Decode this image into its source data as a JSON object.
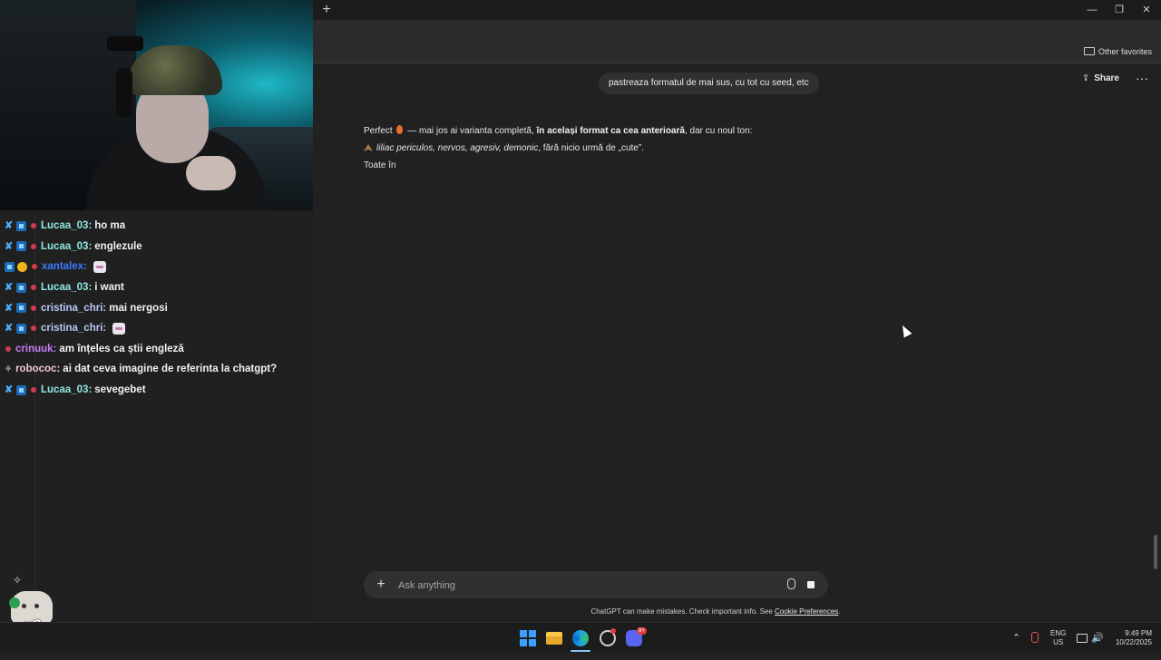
{
  "browser": {
    "newtab_label": "+",
    "window": {
      "minimize": "—",
      "restore": "❐",
      "close": "✕"
    },
    "favorites": {
      "other_label": "Other favorites"
    }
  },
  "chat": {
    "share_label": "Share",
    "more_label": "···",
    "user_message": "pastreaza formatul de mai sus, cu tot cu seed, etc",
    "assistant": {
      "line1_start": "Perfect",
      "line1_mid": " — mai jos ai varianta completă, ",
      "line1_bold": "în același format ca cea anterioară",
      "line1_end": ", dar cu noul ton:",
      "line2_italic": "liliac periculos, nervos, agresiv, demonic",
      "line2_end": ", fără nicio urmă de „cute”.",
      "line3": "Toate în"
    },
    "composer": {
      "placeholder": "Ask anything",
      "plus_label": "+"
    },
    "disclaimer_text": "ChatGPT can make mistakes. Check important info. See ",
    "disclaimer_link": "Cookie Preferences",
    "disclaimer_end": "."
  },
  "stream_chat": {
    "messages": [
      {
        "user": "Lucaa_03",
        "text": "ho ma",
        "color": "#8fe8e0"
      },
      {
        "user": "Lucaa_03",
        "text": "englezule",
        "color": "#8fe8e0"
      },
      {
        "user": "xantalex",
        "text": "",
        "color": "#3a7bff"
      },
      {
        "user": "Lucaa_03",
        "text": "i want",
        "color": "#8fe8e0"
      },
      {
        "user": "cristina_chri",
        "text": "mai nergosi",
        "color": "#b8c6f4"
      },
      {
        "user": "cristina_chri",
        "text": "",
        "color": "#b8c6f4"
      },
      {
        "user": "crinuuk",
        "text": "am înțeles ca știi engleză",
        "color": "#c67cf7"
      },
      {
        "user": "robococ",
        "text": "ai dat ceva imagine de referinta la chatgpt?",
        "color": "#f0c7da"
      },
      {
        "user": "Lucaa_03",
        "text": "sevegebet",
        "color": "#8fe8e0"
      }
    ],
    "combo_label": "x2"
  },
  "taskbar": {
    "lang_line1": "ENG",
    "lang_line2": "US",
    "time": "9:49 PM",
    "date": "10/22/2025",
    "discord_badge": "9+",
    "chevron": "⌃",
    "volume": "🔊"
  }
}
